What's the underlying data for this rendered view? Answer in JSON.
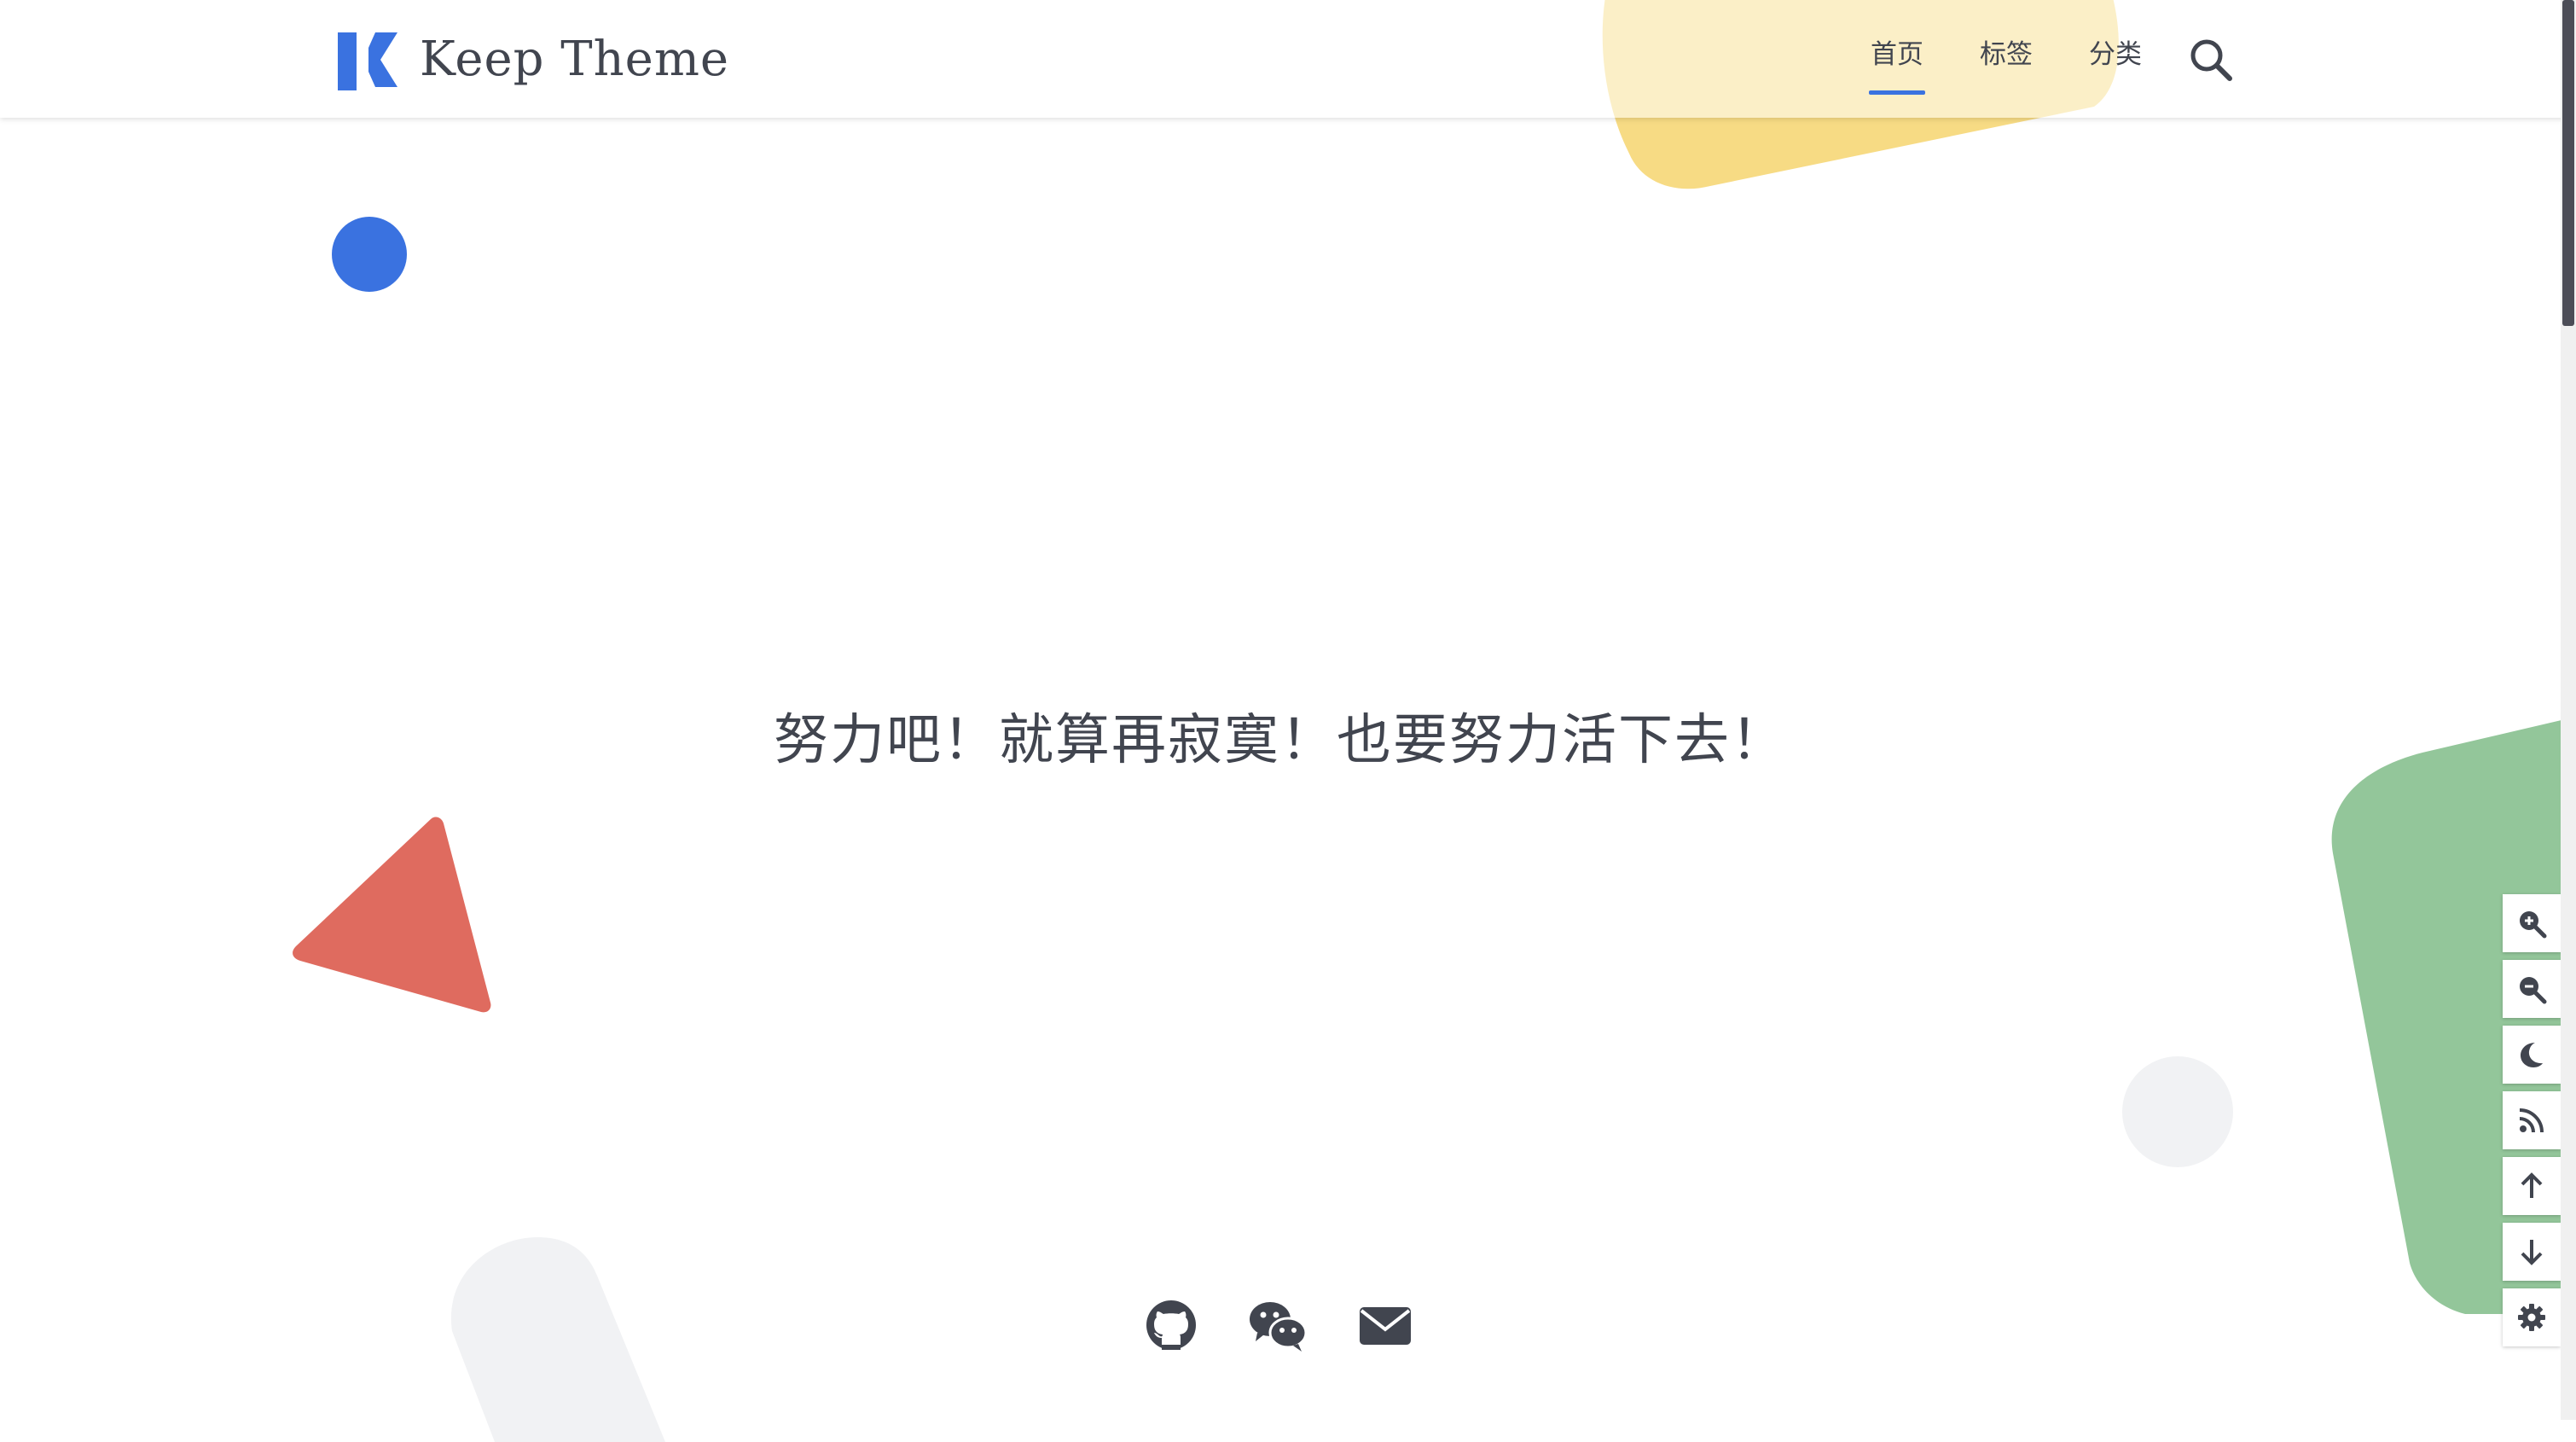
{
  "header": {
    "title": "Keep Theme",
    "nav": [
      {
        "label": "首页",
        "active": true
      },
      {
        "label": "标签",
        "active": false
      },
      {
        "label": "分类",
        "active": false
      }
    ],
    "search_icon": "search-icon"
  },
  "main": {
    "motto": "努力吧！就算再寂寞！也要努力活下去！"
  },
  "social": [
    "github-icon",
    "wechat-icon",
    "email-icon"
  ],
  "tools": [
    "zoom-in-icon",
    "zoom-out-icon",
    "moon-icon",
    "rss-icon",
    "arrow-up-icon",
    "arrow-down-icon",
    "gear-icon"
  ],
  "colors": {
    "accent": "#3a72e0",
    "text": "#41454f",
    "yellow": "#f6d879",
    "green": "#93c69a",
    "red": "#df6b5f",
    "light_grey": "#f1f2f4"
  }
}
